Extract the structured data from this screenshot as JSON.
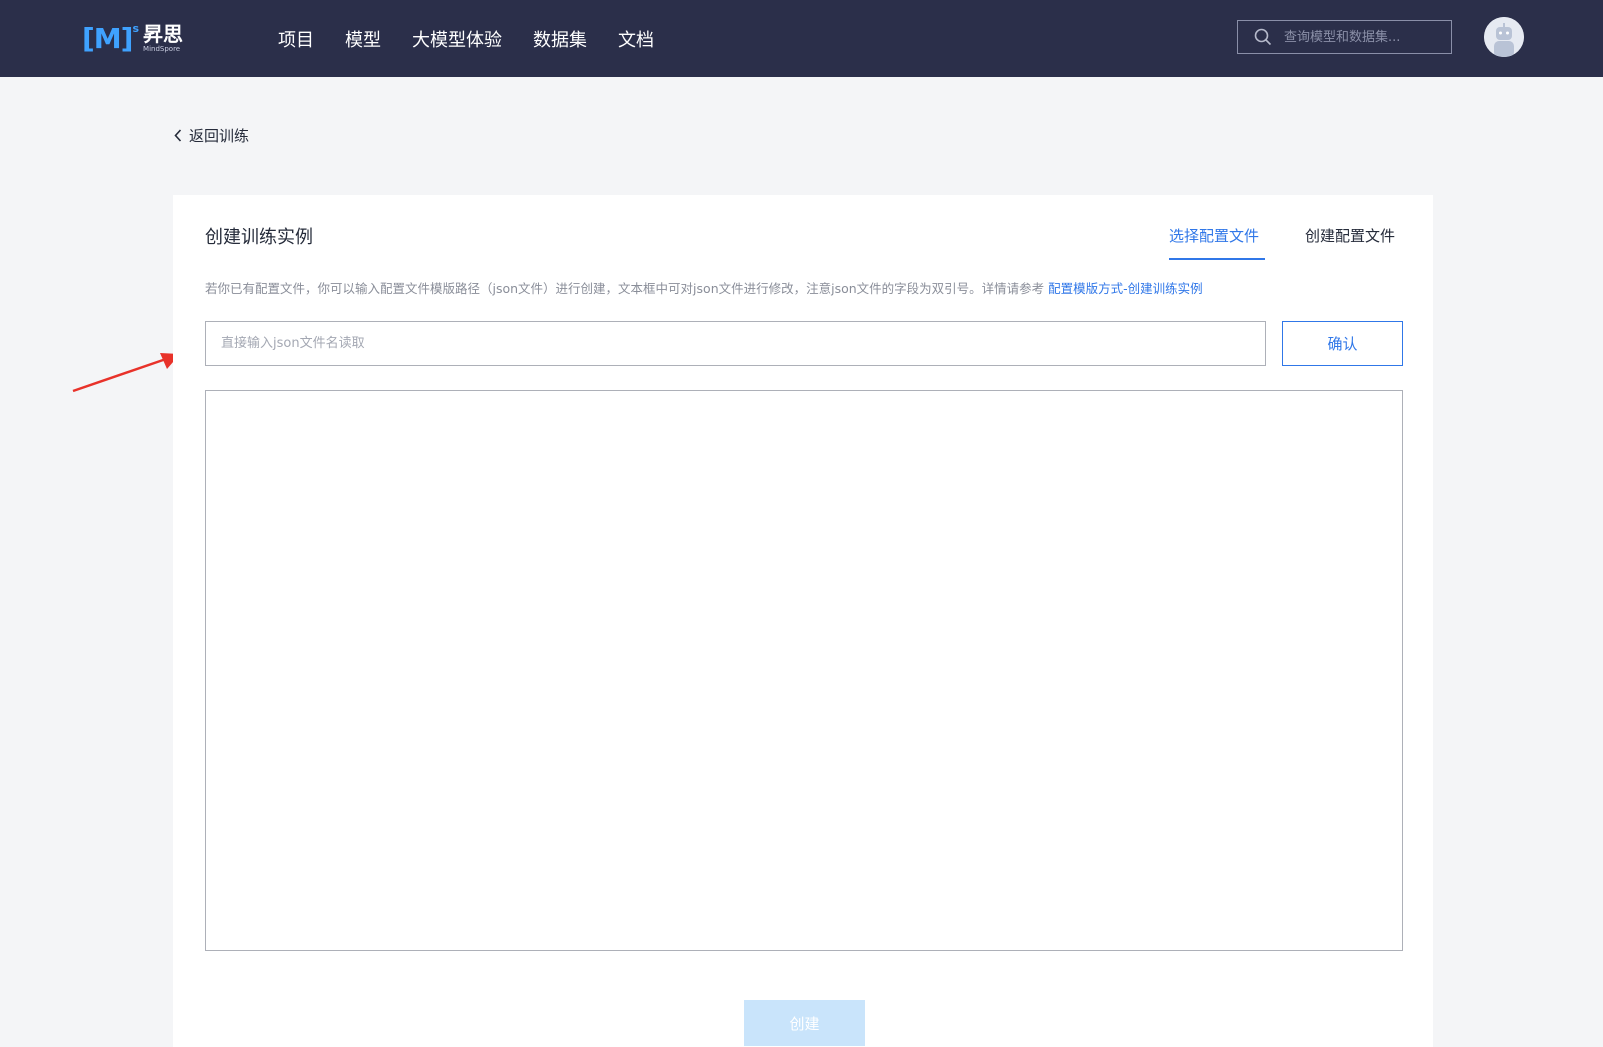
{
  "header": {
    "logo": {
      "mark": "[M]",
      "sup": "s",
      "cn": "昇思",
      "en": "MindSpore"
    },
    "nav": [
      "项目",
      "模型",
      "大模型体验",
      "数据集",
      "文档"
    ],
    "search": {
      "placeholder": "查询模型和数据集..."
    }
  },
  "back_label": "返回训练",
  "card": {
    "title": "创建训练实例",
    "tabs": {
      "select": "选择配置文件",
      "create": "创建配置文件",
      "active": "select"
    },
    "hint": "若你已有配置文件，你可以输入配置文件模版路径（json文件）进行创建，文本框中可对json文件进行修改，注意json文件的字段为双引号。详情请参考",
    "hint_link": "配置模版方式-创建训练实例",
    "path_input": {
      "placeholder": "直接输入json文件名读取",
      "value": ""
    },
    "confirm_label": "确认",
    "json_content": "",
    "create_label": "创建"
  },
  "colors": {
    "topbar": "#2b2f4a",
    "accent": "#3077e8",
    "disabled_button": "#c9e4fb",
    "annotation_arrow": "#e8322a"
  }
}
